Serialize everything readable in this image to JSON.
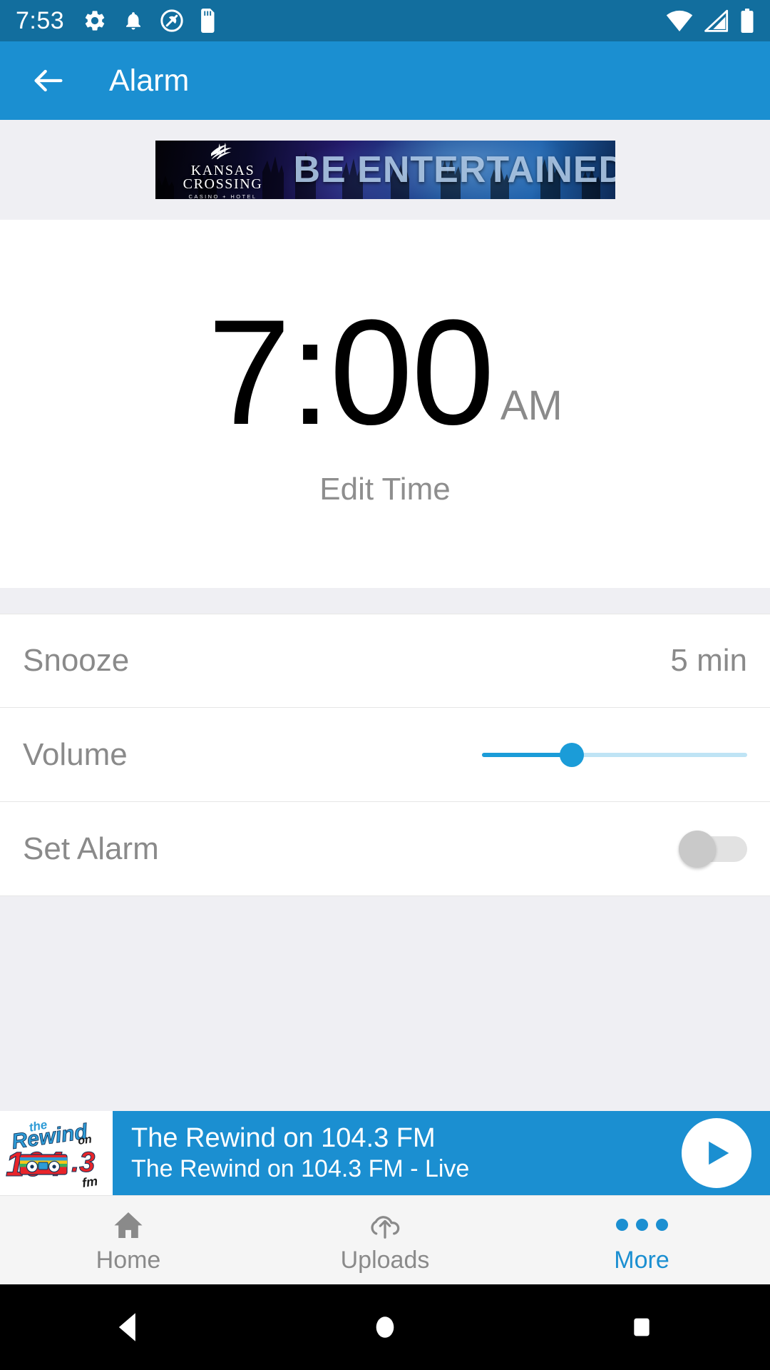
{
  "status_bar": {
    "time": "7:53",
    "background_color": "#126E9E",
    "left_icons": [
      "gear-icon",
      "bell-icon",
      "do-not-disturb-icon",
      "sd-card-icon"
    ],
    "right_icons": [
      "wifi-icon",
      "cellular-signal-icon",
      "battery-icon"
    ]
  },
  "app_bar": {
    "title": "Alarm",
    "back_icon": "arrow-left-icon",
    "background_color": "#1B8FD1"
  },
  "advertisement": {
    "brand": "KANSAS CROSSING",
    "brand_line_1": "KANSAS",
    "brand_line_2": "CROSSING",
    "brand_sub": "CASINO + HOTEL",
    "headline": "BE ENTERTAINED"
  },
  "alarm": {
    "time": "7:00",
    "meridiem": "AM",
    "edit_label": "Edit Time"
  },
  "settings": {
    "rows": [
      {
        "label": "Snooze",
        "value": "5 min",
        "type": "value"
      },
      {
        "label": "Volume",
        "type": "slider",
        "fill_percent": 34
      },
      {
        "label": "Set Alarm",
        "type": "toggle",
        "enabled": "off"
      }
    ]
  },
  "player": {
    "title": "The Rewind on 104.3 FM",
    "subtitle": "The Rewind on 104.3 FM - Live",
    "play_icon": "play-icon",
    "artwork": {
      "line_the": "the",
      "line_rewind": "Rewind",
      "line_on": "on",
      "line_number": "104.3",
      "line_fm": "fm"
    },
    "accent_color": "#1B8FD1"
  },
  "bottom_nav": {
    "items": [
      {
        "label": "Home",
        "icon": "home-icon",
        "active": "false"
      },
      {
        "label": "Uploads",
        "icon": "cloud-upload-icon",
        "active": "false"
      },
      {
        "label": "More",
        "icon": "more-dots-icon",
        "active": "true"
      }
    ],
    "active_color": "#1B8FD1"
  },
  "android_nav": {
    "buttons": [
      "back-triangle-icon",
      "home-circle-icon",
      "recents-square-icon"
    ]
  }
}
